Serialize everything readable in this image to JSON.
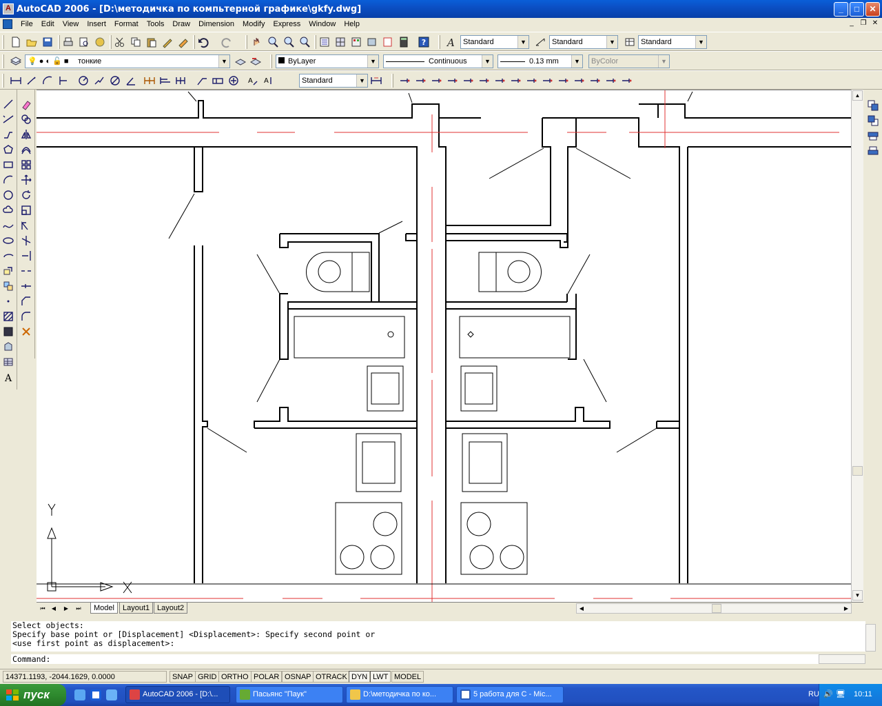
{
  "window": {
    "title": "AutoCAD 2006 - [D:\\методичка по компьтерной графике\\gkfy.dwg]",
    "minimize": "_",
    "maximize": "□",
    "close": "✕"
  },
  "menu": {
    "items": [
      "File",
      "Edit",
      "View",
      "Insert",
      "Format",
      "Tools",
      "Draw",
      "Dimension",
      "Modify",
      "Express",
      "Window",
      "Help"
    ]
  },
  "toolbar1": {
    "text_style": "Standard",
    "dim_style": "Standard",
    "table_style": "Standard"
  },
  "toolbar2": {
    "layer": "тонкие",
    "color": "ByLayer",
    "linetype": "Continuous",
    "lineweight": "0.13 mm",
    "plotstyle": "ByColor"
  },
  "toolbar3": {
    "dim_style": "Standard"
  },
  "ucs": {
    "x_label": "X",
    "y_label": "Y"
  },
  "tabs": {
    "model": "Model",
    "layout1": "Layout1",
    "layout2": "Layout2"
  },
  "command": {
    "line1": "Select objects:",
    "line2": "Specify base point or [Displacement] <Displacement>: Specify second point or",
    "line3": "<use first point as displacement>:",
    "prompt": "Command:"
  },
  "status": {
    "coords": "14371.1193, -2044.1629, 0.0000",
    "buttons": [
      "SNAP",
      "GRID",
      "ORTHO",
      "POLAR",
      "OSNAP",
      "OTRACK",
      "DYN",
      "LWT",
      "MODEL"
    ]
  },
  "taskbar": {
    "start": "пуск",
    "tasks": [
      "AutoCAD 2006 - [D:\\...",
      "Пасьянс \"Паук\"",
      "D:\\методичка по ко...",
      "5 работа для С - Mic..."
    ],
    "lang": "RU",
    "clock": "10:11"
  },
  "colors": {
    "titlebar": "#0b4fc4",
    "axis_red": "#e03030",
    "taskbar": "#2456c7",
    "start": "#2e8a2e"
  }
}
